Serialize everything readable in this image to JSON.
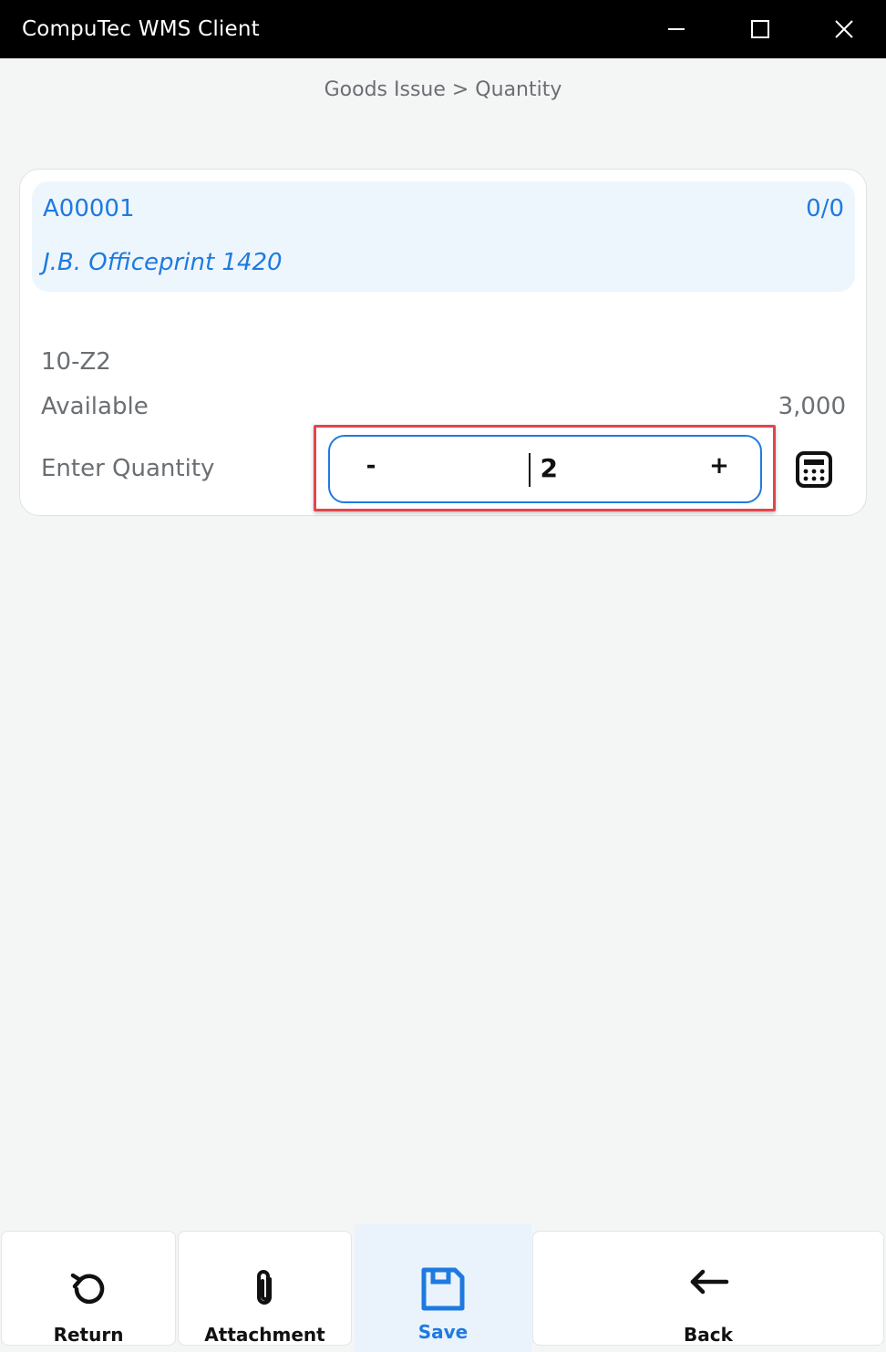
{
  "window": {
    "title": "CompuTec WMS Client"
  },
  "breadcrumb": "Goods Issue > Quantity",
  "item": {
    "code": "A00001",
    "count": "0/0",
    "name": "J.B. Officeprint 1420"
  },
  "details": {
    "bin": "10-Z2",
    "available_label": "Available",
    "available_value": "3,000",
    "quantity_label": "Enter Quantity"
  },
  "stepper": {
    "minus": "-",
    "value": "2",
    "plus": "+"
  },
  "footer": {
    "buttons": [
      {
        "label": "Return",
        "icon": "undo-icon"
      },
      {
        "label": "Attachment",
        "icon": "paperclip-icon"
      },
      {
        "label": "Save",
        "icon": "floppy-disk-icon"
      },
      {
        "label": "Back",
        "icon": "arrow-left-icon"
      }
    ]
  },
  "colors": {
    "accent": "#1f7ae0",
    "titlebar": "#000000",
    "highlight": "#e0464d"
  }
}
